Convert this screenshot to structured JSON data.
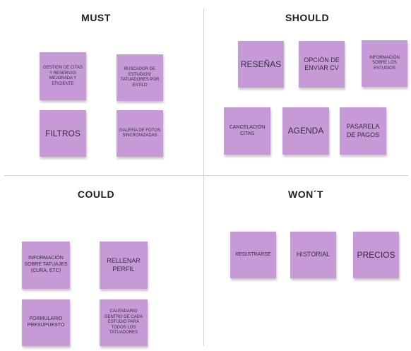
{
  "quadrants": {
    "must": {
      "title": "MUST",
      "notes": [
        "GESTION DE CITAS Y RESERVAS MEJORADA Y EFICIENTE",
        "BUSCADOR DE ESTUDIOS/ TATUADORES POR ESTILO",
        "FILTROS",
        "GALERIA DE FOTOS SINCRONIZADAS"
      ]
    },
    "should": {
      "title": "SHOULD",
      "notes": [
        "RESEÑAS",
        "OPCIÓN DE ENVIAR CV",
        "INFORMACIÓN SOBRE LOS ESTUDIOS",
        "CANCELACIÓN CITAS",
        "AGENDA",
        "PASARELA DE PAGOS"
      ]
    },
    "could": {
      "title": "COULD",
      "notes": [
        "INFORMACIÓN SOBRE TATUAJES (CURA, ETC)",
        "RELLENAR PERFIL",
        "FORMULARIO PRESUPUESTO",
        "CALENDARIO DENTRO DE CADA ESTUDIO PARA TODOS LOS TATUADORES"
      ]
    },
    "wont": {
      "title": "WON´T",
      "notes": [
        "REGISTRARSE",
        "HISTORIAL",
        "PRECIOS"
      ]
    }
  },
  "colors": {
    "note": "#c59ad6",
    "divider": "#d4d4d4",
    "background": "#ffffff"
  }
}
